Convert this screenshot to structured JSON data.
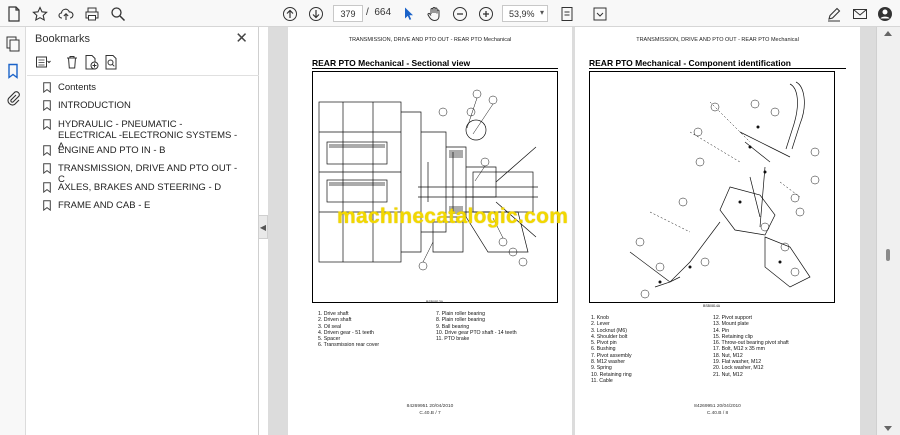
{
  "toolbar": {
    "page_current": "379",
    "page_sep": "/",
    "page_total": "664",
    "zoom": "53,9%",
    "icons": [
      "star-icon",
      "cloud-upload-icon",
      "print-icon",
      "zoom-search-icon",
      "page-up-icon",
      "page-down-icon",
      "select-cursor-icon",
      "hand-icon",
      "zoom-out-icon",
      "zoom-in-icon",
      "fit-page-icon",
      "scroll-mode-icon",
      "edit-sign-icon",
      "mail-icon",
      "account-icon"
    ]
  },
  "bookmarks": {
    "title": "Bookmarks",
    "items": [
      "Contents",
      "INTRODUCTION",
      "HYDRAULIC - PNEUMATIC - ELECTRICAL -ELECTRONIC SYSTEMS - A",
      "ENGINE AND PTO IN - B",
      "TRANSMISSION, DRIVE AND PTO OUT - C",
      "AXLES, BRAKES AND STEERING - D",
      "FRAME AND CAB - E"
    ]
  },
  "pages": [
    {
      "header": "TRANSMISSION, DRIVE AND PTO OUT - REAR PTO Mechanical",
      "title": "REAR PTO Mechanical - Sectional view",
      "fig_code": "BSB0813A",
      "legend_col1": [
        "1.   Drive shaft",
        "2.   Driven shaft",
        "3.   Oil seal",
        "4.   Driven gear - 51 teeth",
        "5.   Spacer",
        "6.   Transmission rear cover"
      ],
      "legend_col2": [
        "7.   Plain roller bearing",
        "8.   Plain roller bearing",
        "9.   Ball bearing",
        "10.  Drive gear PTO shaft - 14 teeth",
        "11.  PTO brake"
      ],
      "footer_code": "84269951 20/04/2010",
      "footer_page": "C.40.B / 7"
    },
    {
      "header": "TRANSMISSION, DRIVE AND PTO OUT - REAR PTO Mechanical",
      "title": "REAR PTO Mechanical - Component identification",
      "fig_code": "BSB0814A",
      "legend_col1": [
        "1.   Knob",
        "2.   Lever",
        "3.   Locknut (M6)",
        "4.   Shoulder bolt",
        "5.   Pivot pin",
        "6.   Bushing",
        "7.   Pivot assembly",
        "8.   M12 washer",
        "9.   Spring",
        "10.  Retaining ring",
        "11.  Cable"
      ],
      "legend_col2": [
        "12.  Pivot support",
        "13.  Mount plate",
        "14.  Pin",
        "15.  Retaining clip",
        "16.  Throw-out bearing pivot shaft",
        "17.  Bolt, M12 x 35 mm",
        "18.  Nut, M12",
        "19.  Flat washer, M12",
        "20.  Lock washer, M12",
        "21.  Nut, M12"
      ],
      "footer_code": "84269951 20/04/2010",
      "footer_page": "C.40.B / 8"
    }
  ],
  "watermark": "machinecatalogic.com",
  "colors": {
    "watermark": "#f2d800",
    "toolbar_bg": "#f8f8f8",
    "doc_bg": "#dcdcdc",
    "bookmark_icon": "#1b63c9"
  }
}
